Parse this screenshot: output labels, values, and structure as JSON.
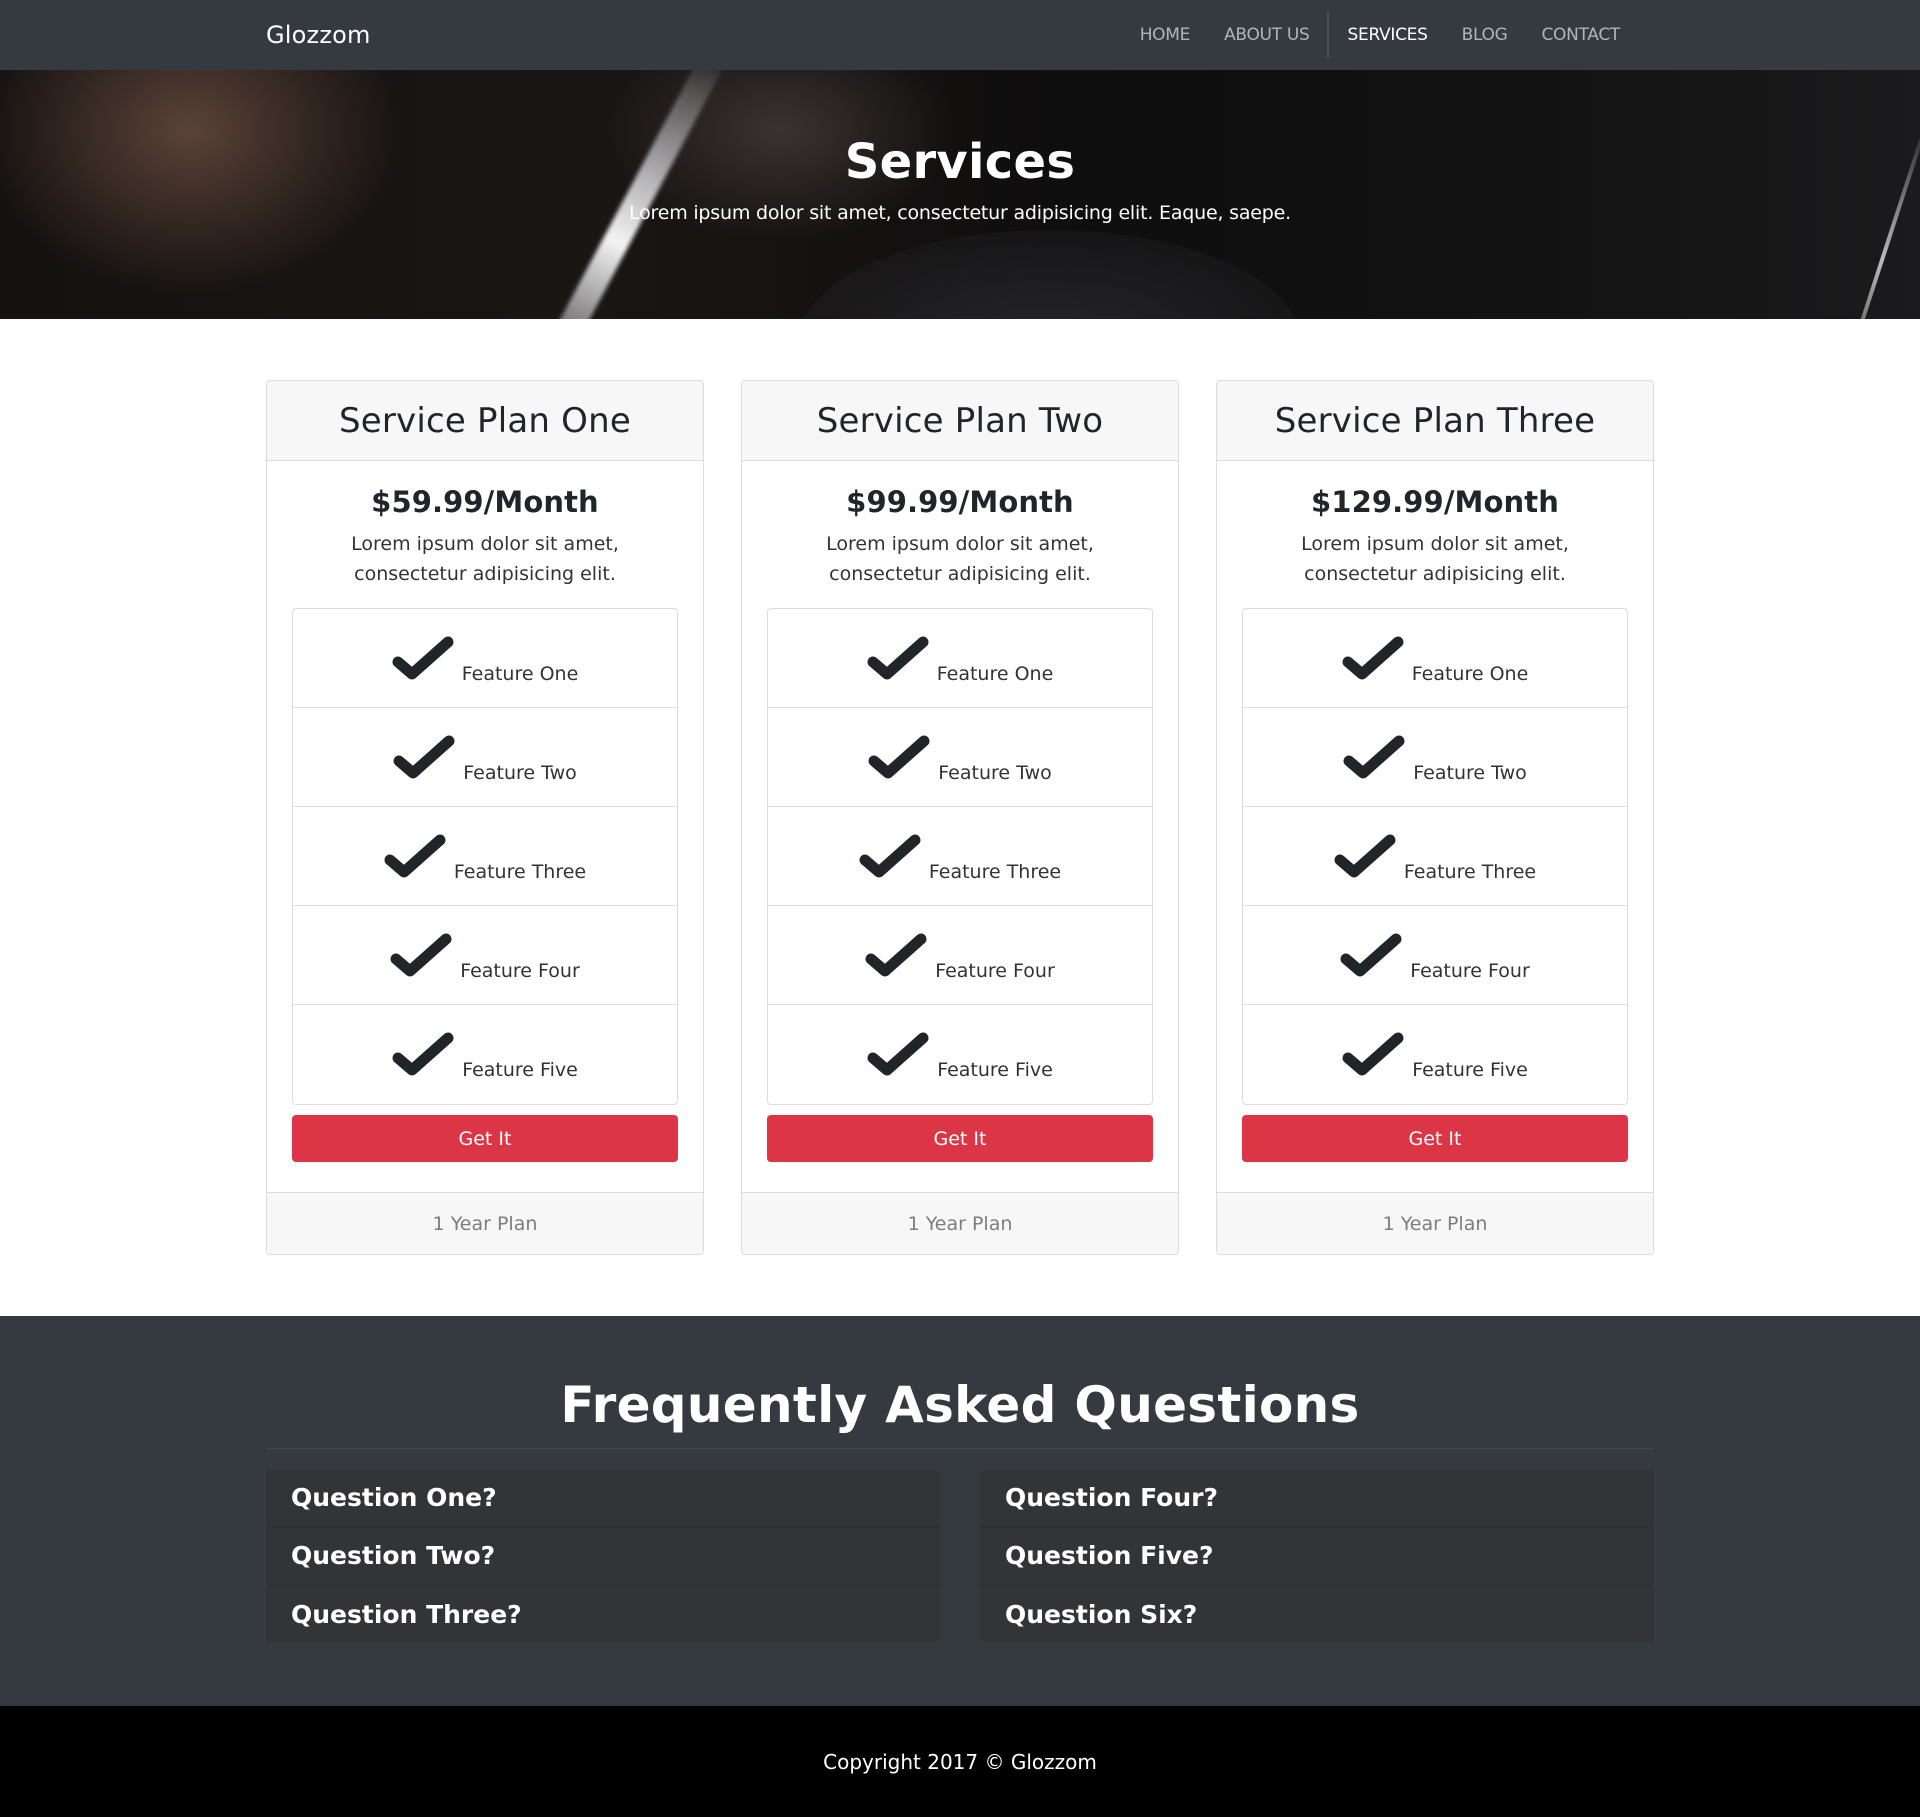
{
  "nav": {
    "brand": "Glozzom",
    "links": [
      {
        "label": "HOME"
      },
      {
        "label": "ABOUT US"
      },
      {
        "label": "SERVICES"
      },
      {
        "label": "BLOG"
      },
      {
        "label": "CONTACT"
      }
    ],
    "active": "SERVICES"
  },
  "hero": {
    "title": "Services",
    "subtitle": "Lorem ipsum dolor sit amet, consectetur adipisicing elit. Eaque, saepe."
  },
  "plans": [
    {
      "name": "Service Plan One",
      "price": "$59.99/Month",
      "description": "Lorem ipsum dolor sit amet, consectetur adipisicing elit.",
      "features": [
        "Feature One",
        "Feature Two",
        "Feature Three",
        "Feature Four",
        "Feature Five"
      ],
      "button": "Get It",
      "footer": "1 Year Plan"
    },
    {
      "name": "Service Plan Two",
      "price": "$99.99/Month",
      "description": "Lorem ipsum dolor sit amet, consectetur adipisicing elit.",
      "features": [
        "Feature One",
        "Feature Two",
        "Feature Three",
        "Feature Four",
        "Feature Five"
      ],
      "button": "Get It",
      "footer": "1 Year Plan"
    },
    {
      "name": "Service Plan Three",
      "price": "$129.99/Month",
      "description": "Lorem ipsum dolor sit amet, consectetur adipisicing elit.",
      "features": [
        "Feature One",
        "Feature Two",
        "Feature Three",
        "Feature Four",
        "Feature Five"
      ],
      "button": "Get It",
      "footer": "1 Year Plan"
    }
  ],
  "feature_icon": "check-icon",
  "faq": {
    "title": "Frequently Asked Questions",
    "left": [
      "Question One?",
      "Question Two?",
      "Question Three?"
    ],
    "right": [
      "Question Four?",
      "Question Five?",
      "Question Six?"
    ]
  },
  "footer": {
    "copyright": "Copyright 2017 © Glozzom"
  },
  "colors": {
    "navbar": "#343a40",
    "accent_button": "#dc3545",
    "footer": "#000000"
  }
}
